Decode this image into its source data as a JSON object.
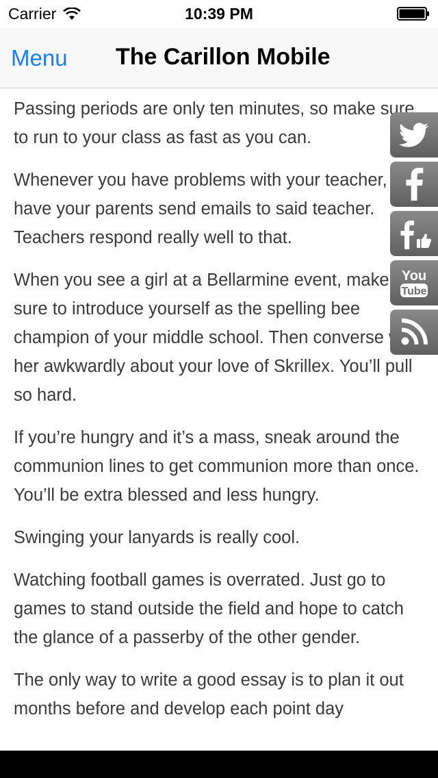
{
  "status_bar": {
    "carrier": "Carrier",
    "time": "10:39 PM"
  },
  "nav": {
    "menu_label": "Menu",
    "title": "The Carillon Mobile"
  },
  "article": {
    "paragraphs": [
      "Passing periods are only ten minutes, so make sure to run to your class as fast as you can.",
      "Whenever you have problems with your teacher, have your parents send emails to said teacher. Teachers respond really well to that.",
      "When you see a girl at a Bellarmine event, make sure to introduce yourself as the spelling bee champion of your middle school. Then converse with her awkwardly about your love of Skrillex. You’ll pull so hard.",
      "If you’re hungry and it’s a mass, sneak around the communion lines to get communion more than once. You’ll be extra blessed and less hungry.",
      "Swinging your lanyards is really cool.",
      "Watching football games is overrated. Just go to games to stand outside the field and hope to catch the glance of a passerby of the other gender.",
      "The only way to write a good essay is to plan it out months before and develop each point day"
    ]
  },
  "social": {
    "youtube_logo": "You Tube",
    "icons": [
      "twitter-icon",
      "facebook-icon",
      "facebook-like-icon",
      "youtube-icon",
      "rss-icon"
    ]
  },
  "colors": {
    "accent": "#1a7ff5",
    "text": "#3a3a3a",
    "social_bg": "#6e6e6e"
  }
}
